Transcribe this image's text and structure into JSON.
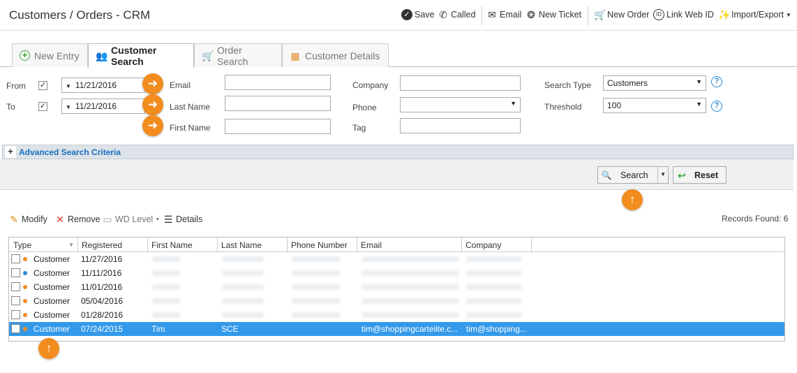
{
  "header": {
    "title": "Customers / Orders - CRM",
    "save": "Save",
    "called": "Called",
    "email": "Email",
    "new_ticket": "New Ticket",
    "new_order": "New Order",
    "link_web_id": "Link Web ID",
    "import_export": "Import/Export"
  },
  "tabs": [
    {
      "label": "New Entry"
    },
    {
      "label": "Customer Search"
    },
    {
      "label": "Order Search"
    },
    {
      "label": "Customer Details"
    }
  ],
  "search": {
    "from_label": "From",
    "to_label": "To",
    "from_date": "11/21/2016",
    "to_date": "11/21/2016",
    "email_label": "Email",
    "last_name_label": "Last Name",
    "first_name_label": "First Name",
    "company_label": "Company",
    "phone_label": "Phone",
    "tag_label": "Tag",
    "search_type_label": "Search Type",
    "search_type_value": "Customers",
    "threshold_label": "Threshold",
    "threshold_value": "100",
    "advanced_label": "Advanced Search Criteria",
    "search_button": "Search",
    "reset_button": "Reset"
  },
  "grid_toolbar": {
    "modify": "Modify",
    "remove": "Remove",
    "wd_level": "WD Level",
    "details": "Details",
    "records_found": "Records Found: 6"
  },
  "grid": {
    "columns": [
      "Type",
      "Registered",
      "First Name",
      "Last Name",
      "Phone Number",
      "Email",
      "Company"
    ],
    "rows": [
      {
        "type": "Customer",
        "registered": "11/27/2016",
        "first_name": "",
        "last_name": "",
        "email": "",
        "company": "",
        "dot": "#f28c1e"
      },
      {
        "type": "Customer",
        "registered": "11/11/2016",
        "first_name": "",
        "last_name": "",
        "email": "",
        "company": "",
        "dot": "#2a8ad4"
      },
      {
        "type": "Customer",
        "registered": "11/01/2016",
        "first_name": "",
        "last_name": "",
        "email": "",
        "company": "",
        "dot": "#f28c1e"
      },
      {
        "type": "Customer",
        "registered": "05/04/2016",
        "first_name": "",
        "last_name": "",
        "email": "",
        "company": "",
        "dot": "#f28c1e"
      },
      {
        "type": "Customer",
        "registered": "01/28/2016",
        "first_name": "",
        "last_name": "",
        "email": "",
        "company": "",
        "dot": "#f28c1e"
      },
      {
        "type": "Customer",
        "registered": "07/24/2015",
        "first_name": "Tim",
        "last_name": "SCE",
        "email": "tim@shoppingcartelite.c...",
        "company": "tim@shopping...",
        "dot": "#f28c1e"
      }
    ]
  },
  "colors": {
    "accent": "#f28c1e",
    "selection": "#3399ea",
    "link": "#1a6fc2"
  }
}
